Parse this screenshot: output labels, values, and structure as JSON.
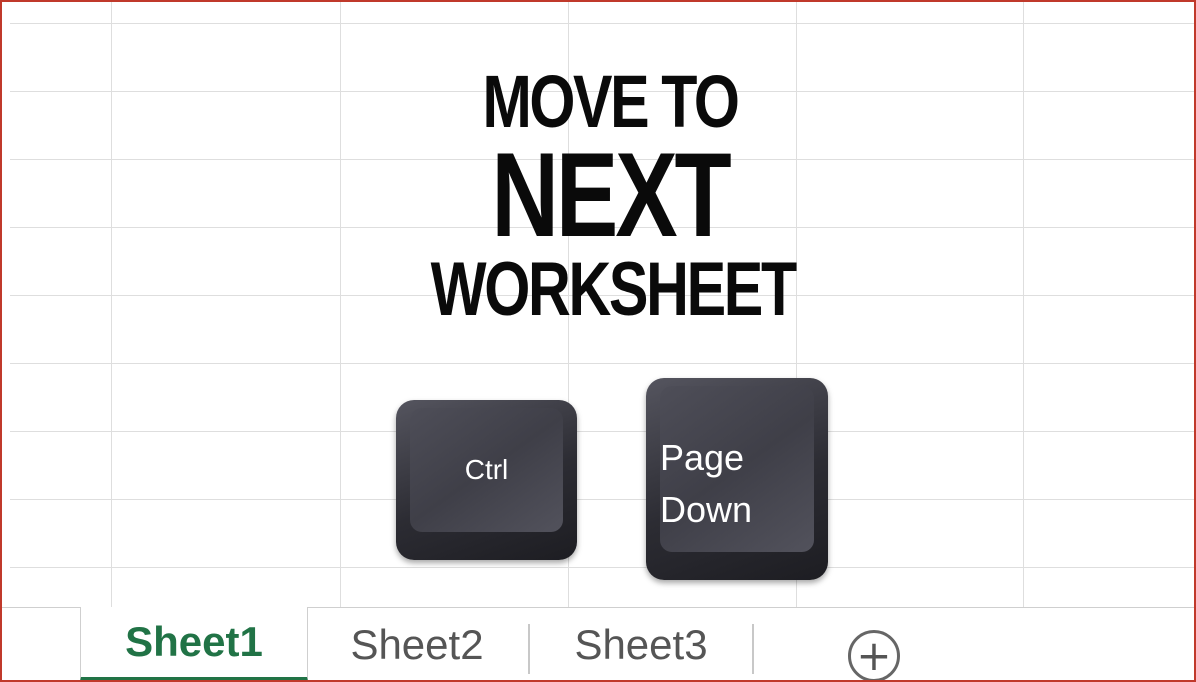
{
  "title": {
    "line1": "MOVE TO",
    "line2": "NEXT",
    "line3": "WORKSHEET"
  },
  "keys": {
    "ctrl": "Ctrl",
    "page_down_line1": "Page",
    "page_down_line2": "Down"
  },
  "tabs": [
    {
      "label": "Sheet1",
      "active": true
    },
    {
      "label": "Sheet2",
      "active": false
    },
    {
      "label": "Sheet3",
      "active": false
    }
  ],
  "add_sheet_icon": "plus-circle-icon",
  "colors": {
    "active_tab": "#217346",
    "frame_border": "#c0392b",
    "key_body": "#2c2c33"
  }
}
